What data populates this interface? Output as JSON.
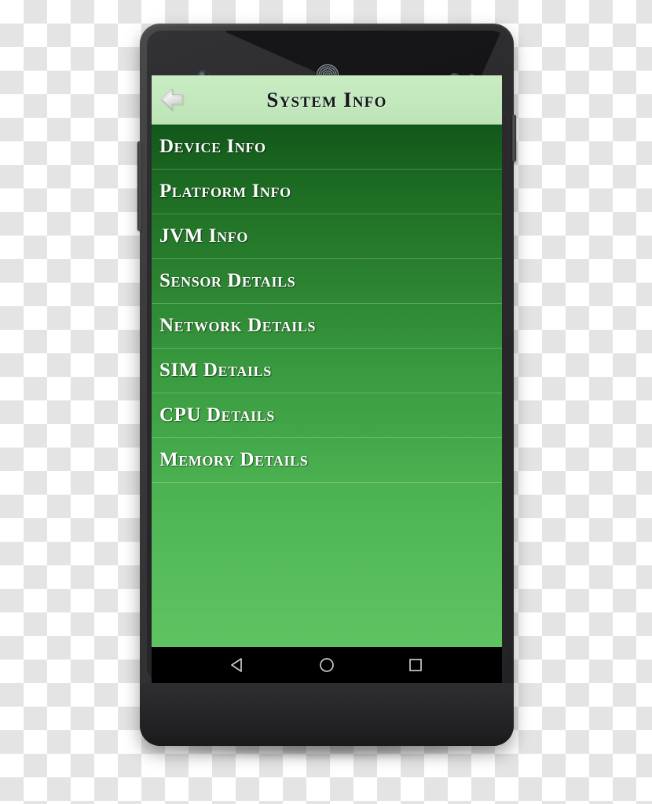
{
  "app": {
    "title": "System Info",
    "back_icon": "back-arrow-icon"
  },
  "menu": {
    "items": [
      {
        "label": "Device Info",
        "name": "device-info"
      },
      {
        "label": "Platform Info",
        "name": "platform-info"
      },
      {
        "label": "JVM Info",
        "name": "jvm-info"
      },
      {
        "label": "Sensor Details",
        "name": "sensor-details"
      },
      {
        "label": "Network Details",
        "name": "network-details"
      },
      {
        "label": "SIM Details",
        "name": "sim-details"
      },
      {
        "label": "CPU Details",
        "name": "cpu-details"
      },
      {
        "label": "Memory Details",
        "name": "memory-details"
      }
    ]
  },
  "navbar": {
    "back_label": "Back",
    "home_label": "Home",
    "recents_label": "Recent apps"
  },
  "hardware": {
    "front_camera": "front-camera",
    "earpiece": "earpiece-speaker",
    "proximity_sensor": "proximity-sensor",
    "light_sensor": "light-sensor",
    "power_button": "Power",
    "volume_button": "Volume"
  },
  "colors": {
    "app_bar": "#c3e8bd",
    "list_top": "#12571a",
    "list_bottom": "#5ec462",
    "title_text": "#14171c",
    "item_text": "#ffffff",
    "nav_bar": "#000000",
    "device_body": "#2b2b2e"
  }
}
